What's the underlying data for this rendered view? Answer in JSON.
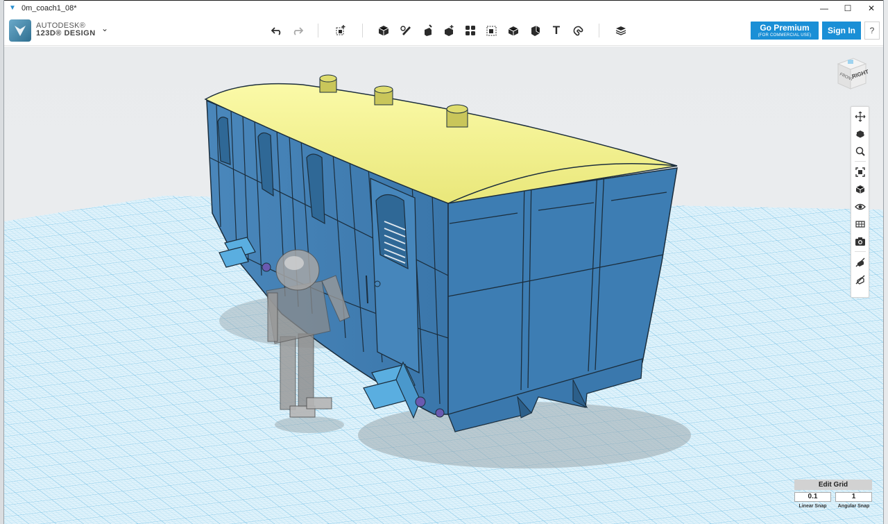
{
  "window": {
    "title": "0m_coach1_08*",
    "minimize_glyph": "—",
    "maximize_glyph": "☐",
    "close_glyph": "✕"
  },
  "app": {
    "brand_line1": "AUTODESK®",
    "brand_line2": "123D® DESIGN",
    "menu_caret": "⌄",
    "go_premium": "Go Premium",
    "go_premium_sub": "(FOR COMMERCIAL USE)",
    "sign_in": "Sign In",
    "help": "?"
  },
  "toolbar": {
    "icons": [
      "undo-icon",
      "redo-icon",
      "transform-icon",
      "primitives-icon",
      "sketch-icon",
      "construct-icon",
      "modify-icon",
      "pattern-icon",
      "grouping-icon",
      "combine-icon",
      "measure-icon",
      "text-icon",
      "snap-icon",
      "material-icon"
    ],
    "text_tool": "T"
  },
  "viewcube": {
    "front_label": "FRONT",
    "right_label": "RIGHT"
  },
  "navbar": {
    "icons": [
      "pan-icon",
      "orbit-icon",
      "zoom-icon",
      "fit-icon",
      "view-icon",
      "visibility-icon",
      "material-view-icon",
      "snapshot-icon",
      "hide-icon",
      "show-icon"
    ]
  },
  "edit_grid": {
    "title": "Edit Grid",
    "linear_snap_value": "0.1",
    "linear_snap_label": "Linear Snap",
    "angular_snap_value": "1",
    "angular_snap_label": "Angular Snap"
  },
  "colors": {
    "accent": "#1a8fd6",
    "coach_body": "#3d7db3",
    "coach_roof": "#f0ef8a",
    "grid_line": "#7dc4e6",
    "figure": "#8d8d8d"
  }
}
